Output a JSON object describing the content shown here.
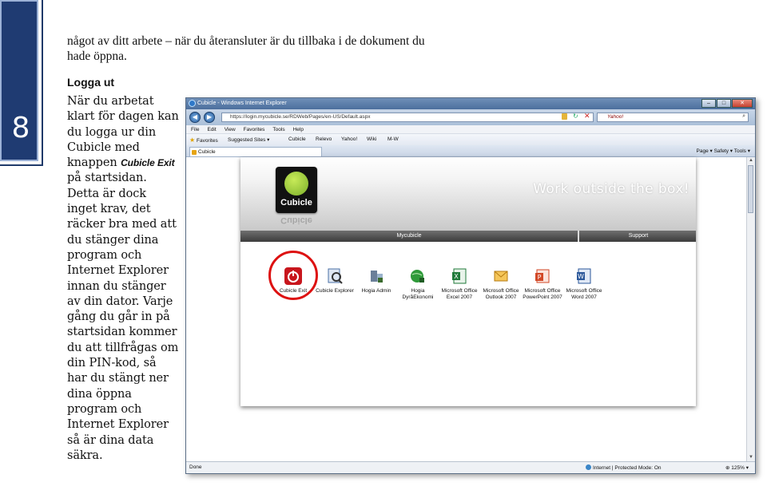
{
  "page": {
    "number": "8",
    "intro_text": "något av ditt arbete – när du återansluter är du tillbaka i de dokument du hade öppna.",
    "heading": "Logga ut",
    "body_before": "När du arbetat klart för dagen kan du logga ur din Cubicle med knappen ",
    "body_ui_term": "Cubicle Exit",
    "body_after": " på startsidan. Detta är dock inget krav, det räcker bra med att du stänger dina program och Internet Explorer innan du stänger av din dator. Varje gång du går in på startsidan kommer du att tillfrågas om din PIN-kod, så har du stängt ner dina öppna program och Internet Explorer så är dina data säkra."
  },
  "browser": {
    "title": "Cubicle - Windows Internet Explorer",
    "url": "https://login.mycubicle.se/RDWeb/Pages/en-US/Default.aspx",
    "search_placeholder": "Yahoo!",
    "menu": [
      "File",
      "Edit",
      "View",
      "Favorites",
      "Tools",
      "Help"
    ],
    "favorites": {
      "label": "Favorites",
      "items": [
        "Suggested Sites ▾",
        "Cubicle",
        "Relevo",
        "Yahoo!",
        "Wiki",
        "M-W"
      ]
    },
    "tab_title": "Cubicle",
    "command_bar": "Page ▾  Safety ▾  Tools ▾",
    "status": "Done",
    "zone": "Internet | Protected Mode: On",
    "zoom": "125%",
    "colors": {
      "chrome": "#c8d6e8",
      "titlebar": "#4c6f9d"
    }
  },
  "cubicle_page": {
    "logo_text": "Cubicle",
    "tagline": "Work outside the box!",
    "nav": {
      "mycubicle": "Mycubicle",
      "support": "Support"
    },
    "apps": [
      {
        "label": "Cubicle Exit",
        "icon": "power-icon",
        "color": "#c8161d"
      },
      {
        "label": "Cubicle Explorer",
        "icon": "magnifier-icon",
        "color": "#4a6fa5"
      },
      {
        "label": "Hogia Admin",
        "icon": "hogia-admin-icon",
        "color": "#3b6b2e"
      },
      {
        "label": "Hogia DyråEkonomi",
        "icon": "globe-icon",
        "color": "#2f9a3a"
      },
      {
        "label": "Microsoft Office Excel 2007",
        "icon": "excel-icon",
        "color": "#1f7a3a"
      },
      {
        "label": "Microsoft Office Outlook 2007",
        "icon": "outlook-icon",
        "color": "#e5a11d"
      },
      {
        "label": "Microsoft Office PowerPoint 2007",
        "icon": "powerpoint-icon",
        "color": "#d24726"
      },
      {
        "label": "Microsoft Office Word 2007",
        "icon": "word-icon",
        "color": "#2b579a"
      }
    ]
  }
}
